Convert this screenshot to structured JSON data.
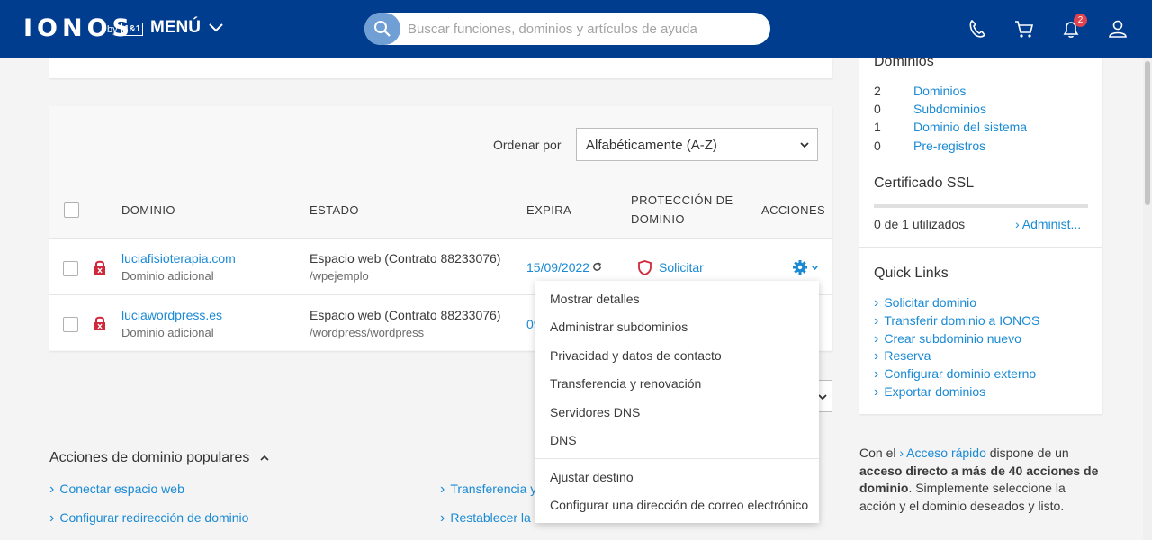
{
  "header": {
    "logo": "IONOS",
    "logo_by": "by",
    "logo_brand": "1&1",
    "menu_label": "MENÚ",
    "search_placeholder": "Buscar funciones, dominios y artículos de ayuda",
    "notifications_count": "2",
    "icons": [
      "phone-icon",
      "cart-icon",
      "bell-icon",
      "user-icon"
    ]
  },
  "sort": {
    "label": "Ordenar por",
    "value": "Alfabéticamente (A-Z)"
  },
  "table": {
    "headers": {
      "domain": "DOMINIO",
      "status": "ESTADO",
      "expires": "EXPIRA",
      "protection_line1": "PROTECCIÓN DE",
      "protection_line2": "DOMINIO",
      "actions": "ACCIONES"
    },
    "rows": [
      {
        "domain": "luciafisioterapia.com",
        "type": "Dominio adicional",
        "status": "Espacio web (Contrato 88233076)",
        "path": "/wpejemplo",
        "expires": "15/09/2022",
        "protection": "Solicitar"
      },
      {
        "domain": "luciawordpress.es",
        "type": "Dominio adicional",
        "status": "Espacio web (Contrato 88233076)",
        "path": "/wordpress/wordpress",
        "expires": "09"
      }
    ]
  },
  "actions_menu": {
    "items": [
      "Mostrar detalles",
      "Administrar subdominios",
      "Privacidad y datos de contacto",
      "Transferencia y renovación",
      "Servidores DNS",
      "DNS",
      "Ajustar destino",
      "Configurar una dirección de correo electrónico"
    ]
  },
  "sidebar": {
    "domains_title": "Dominios",
    "domain_counts": [
      {
        "count": "2",
        "label": "Dominios"
      },
      {
        "count": "0",
        "label": "Subdominios"
      },
      {
        "count": "1",
        "label": "Dominio del sistema"
      },
      {
        "count": "0",
        "label": "Pre-registros"
      }
    ],
    "ssl_title": "Certificado SSL",
    "ssl_usage": "0 de 1 utilizados",
    "ssl_usage_fraction": 0,
    "ssl_link": "Administ...",
    "quick_links_title": "Quick Links",
    "quick_links": [
      "Solicitar dominio",
      "Transferir dominio a IONOS",
      "Crear subdominio nuevo",
      "Reserva",
      "Configurar dominio externo",
      "Exportar dominios"
    ],
    "note_pre": "Con el",
    "note_link": "Acceso rápido",
    "note_mid": "dispone de un",
    "note_bold": "acceso directo a más de 40 acciones de dominio",
    "note_post": ". Simplemente seleccione la acción y el dominio deseados y listo."
  },
  "popular": {
    "title": "Acciones de dominio populares",
    "links_left": [
      "Conectar espacio web",
      "Configurar redirección de dominio"
    ],
    "links_right": [
      "Transferencia y",
      "Restablecer la c"
    ]
  },
  "colors": {
    "header_bg": "#003d8f",
    "link": "#1a8ad4",
    "danger": "#d0283a"
  }
}
